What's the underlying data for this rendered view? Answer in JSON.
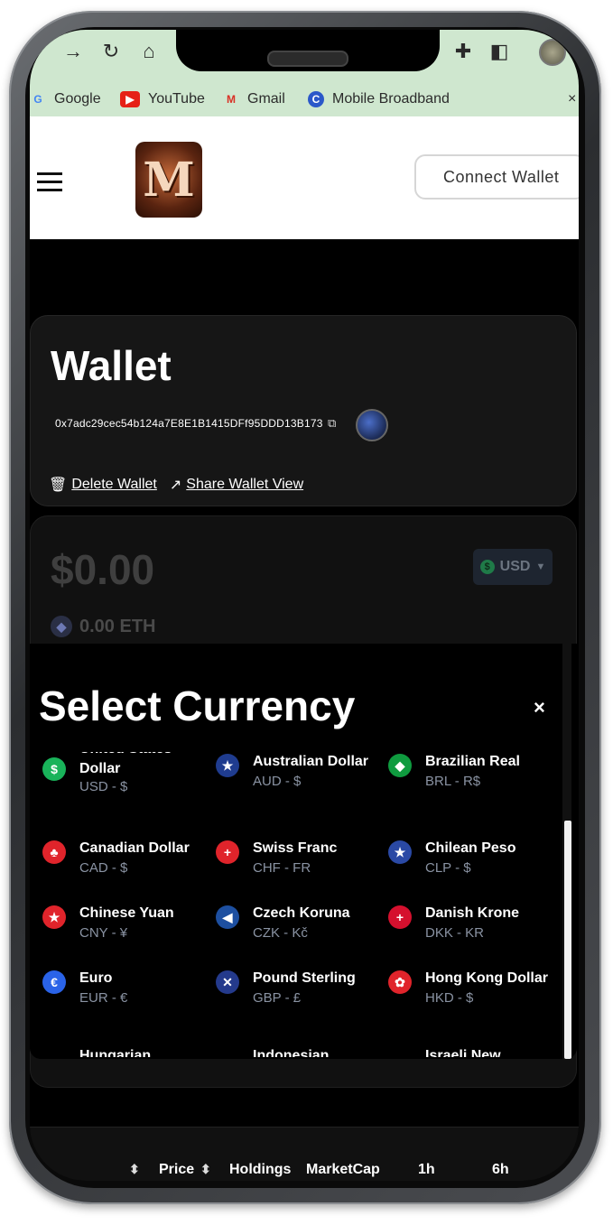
{
  "browser": {
    "bookmarks": [
      {
        "label": "Google",
        "icon": "google-icon"
      },
      {
        "label": "YouTube",
        "icon": "youtube-icon"
      },
      {
        "label": "Gmail",
        "icon": "gmail-icon"
      },
      {
        "label": "Mobile Broadband",
        "icon": "broadband-icon"
      }
    ],
    "overflow_close": "×"
  },
  "header": {
    "logo_letter": "M",
    "connect_label": "Connect Wallet"
  },
  "wallet": {
    "title": "Wallet",
    "address": "0x7adc29cec54b124a7E8E1B1415DFf95DDD13B173",
    "delete_label": "Delete Wallet",
    "share_label": "Share Wallet View"
  },
  "balance": {
    "amount": "$0.00",
    "currency_selected": "USD",
    "eth": "0.00 ETH"
  },
  "modal": {
    "title": "Select Currency",
    "close": "×",
    "currencies": [
      {
        "name": "United States Dollar",
        "code": "USD - $",
        "icon": "dollar-icon",
        "color": "#19b35a",
        "glyph": "$"
      },
      {
        "name": "Australian Dollar",
        "code": "AUD - $",
        "icon": "australia-flag-icon",
        "color": "#1f3c8f",
        "glyph": "★"
      },
      {
        "name": "Brazilian Real",
        "code": "BRL - R$",
        "icon": "brazil-flag-icon",
        "color": "#0f9b3f",
        "glyph": "◆"
      },
      {
        "name": "Canadian Dollar",
        "code": "CAD - $",
        "icon": "canada-flag-icon",
        "color": "#e0242b",
        "glyph": "♣"
      },
      {
        "name": "Swiss Franc",
        "code": "CHF - FR",
        "icon": "swiss-flag-icon",
        "color": "#e0242b",
        "glyph": "+"
      },
      {
        "name": "Chilean Peso",
        "code": "CLP - $",
        "icon": "chile-flag-icon",
        "color": "#2a49a5",
        "glyph": "★"
      },
      {
        "name": "Chinese Yuan",
        "code": "CNY - ¥",
        "icon": "china-flag-icon",
        "color": "#e0242b",
        "glyph": "★"
      },
      {
        "name": "Czech Koruna",
        "code": "CZK - Kč",
        "icon": "czech-flag-icon",
        "color": "#1d4fa0",
        "glyph": "◀"
      },
      {
        "name": "Danish Krone",
        "code": "DKK - KR",
        "icon": "denmark-flag-icon",
        "color": "#d5102e",
        "glyph": "+"
      },
      {
        "name": "Euro",
        "code": "EUR - €",
        "icon": "euro-icon",
        "color": "#2a63e8",
        "glyph": "€"
      },
      {
        "name": "Pound Sterling",
        "code": "GBP - £",
        "icon": "uk-flag-icon",
        "color": "#243a8c",
        "glyph": "✕"
      },
      {
        "name": "Hong Kong Dollar",
        "code": "HKD - $",
        "icon": "hongkong-flag-icon",
        "color": "#e0242b",
        "glyph": "✿"
      },
      {
        "name": "Hungarian",
        "code": "",
        "icon": "hungary-flag-icon",
        "color": "#000000",
        "glyph": ""
      },
      {
        "name": "Indonesian",
        "code": "",
        "icon": "indonesia-flag-icon",
        "color": "#000000",
        "glyph": ""
      },
      {
        "name": "Israeli New",
        "code": "",
        "icon": "israel-flag-icon",
        "color": "#000000",
        "glyph": ""
      }
    ]
  },
  "table": {
    "headers": [
      "Price",
      "Holdings",
      "MarketCap",
      "1h",
      "6h"
    ]
  }
}
